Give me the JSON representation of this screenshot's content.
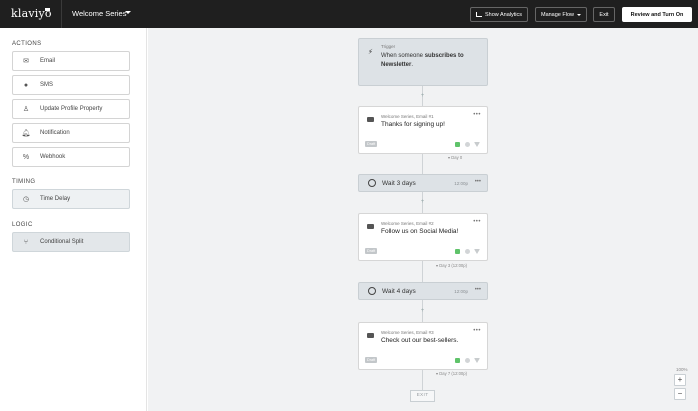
{
  "topbar": {
    "logo": "klaviyo",
    "flow_name": "Welcome Series",
    "buttons": {
      "show_analytics": "Show Analytics",
      "manage_flow": "Manage Flow",
      "exit": "Exit",
      "review": "Review and Turn On"
    }
  },
  "sidebar": {
    "actions_heading": "ACTIONS",
    "actions": [
      "Email",
      "SMS",
      "Update Profile Property",
      "Notification",
      "Webhook"
    ],
    "timing_heading": "TIMING",
    "timing": [
      "Time Delay"
    ],
    "logic_heading": "LOGIC",
    "logic": [
      "Conditional Split"
    ]
  },
  "flow": {
    "trigger": {
      "label": "Trigger",
      "text_prefix": "When someone",
      "text_bold": "subscribes to Newsletter",
      "text_suffix": "."
    },
    "emails": [
      {
        "label": "Welcome Series, Email #1",
        "subject": "Thanks for signing up!",
        "status": "Draft",
        "day": "Day 0"
      },
      {
        "label": "Welcome Series, Email #2",
        "subject": "Follow us on Social Media!",
        "status": "Draft",
        "day": "Day 3 (12:00p)"
      },
      {
        "label": "Welcome Series, Email #3",
        "subject": "Check out our best-sellers.",
        "status": "Draft",
        "day": "Day 7 (12:00p)"
      }
    ],
    "waits": [
      {
        "text": "Wait 3 days",
        "time": "12:00p"
      },
      {
        "text": "Wait 4 days",
        "time": "12:00p"
      }
    ],
    "exit_label": "EXIT"
  },
  "zoom": {
    "level": "100%",
    "in": "+",
    "out": "−"
  },
  "colors": {
    "topbar": "#1f1f1f",
    "canvas": "#f1f2f3",
    "node_grey": "#dde2e6",
    "preview_green": "#5fc36a"
  }
}
